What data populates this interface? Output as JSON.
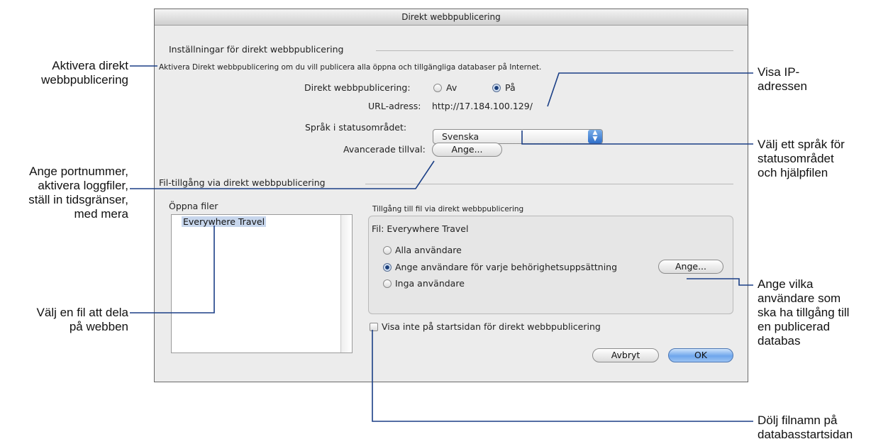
{
  "window": {
    "title": "Direkt webbpublicering"
  },
  "settings": {
    "section_title": "Inställningar för direkt webbpublicering",
    "description": "Aktivera Direkt webbpublicering om du vill publicera alla öppna och tillgängliga databaser på Internet.",
    "publishing_label": "Direkt webbpublicering:",
    "radio_off": "Av",
    "radio_on": "På",
    "publishing_selected": "På",
    "url_label": "URL-adress:",
    "url_value": "http://17.184.100.129/",
    "language_label": "Språk i statusområdet:",
    "language_value": "Svenska",
    "advanced_label": "Avancerade tillval:",
    "advanced_button": "Ange..."
  },
  "file_access": {
    "section_title": "Fil-tillgång via direkt webbpublicering",
    "open_files_label": "Öppna filer",
    "files": [
      "Everywhere Travel"
    ],
    "selected_file": "Everywhere Travel",
    "group_title": "Tillgång till fil via direkt webbpublicering",
    "file_line": "Fil: Everywhere Travel",
    "option_all": "Alla användare",
    "option_specify": "Ange användare för varje behörighetsuppsättning",
    "option_none": "Inga användare",
    "selected_option": "Ange användare för varje behörighetsuppsättning",
    "specify_button": "Ange...",
    "hide_checkbox_label": "Visa inte på startsidan för direkt webbpublicering",
    "hide_checked": false
  },
  "buttons": {
    "cancel": "Avbryt",
    "ok": "OK"
  },
  "callouts": {
    "activate": [
      "Aktivera direkt",
      "webbpublicering"
    ],
    "port": [
      "Ange portnummer,",
      "aktivera loggfiler,",
      "ställ in tidsgränser,",
      "med mera"
    ],
    "choose_file": [
      "Välj en fil att dela",
      "på webben"
    ],
    "ip": [
      "Visa IP-",
      "adressen"
    ],
    "language": [
      "Välj ett språk för",
      "statusområdet",
      "och hjälpfilen"
    ],
    "users": [
      "Ange vilka",
      "användare som",
      "ska ha tillgång till",
      "en publicerad",
      "databas"
    ],
    "hide_name": [
      "Dölj filnamn på",
      "databasstartsidan"
    ]
  },
  "colors": {
    "callout_line": "#1b3f86",
    "selection": "#c7d6ec",
    "ok_button": "#6ea6ec"
  }
}
